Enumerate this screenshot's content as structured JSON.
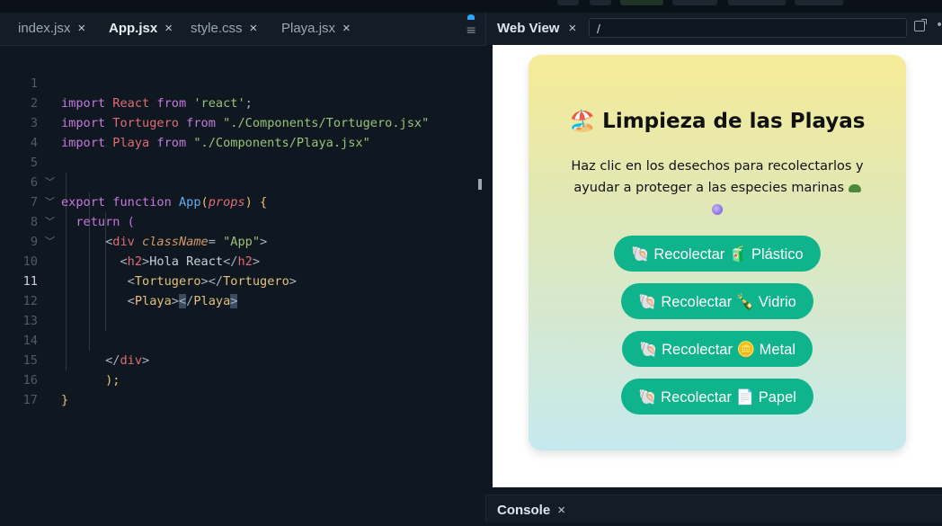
{
  "editor": {
    "tabs": [
      {
        "label": "index.jsx",
        "close": "×"
      },
      {
        "label": "App.jsx",
        "close": "×"
      },
      {
        "label": "style.css",
        "close": "×"
      },
      {
        "label": "Playa.jsx",
        "close": "×"
      }
    ],
    "active_tab": "App.jsx",
    "menu_icon": "≡",
    "line_numbers": [
      "1",
      "2",
      "3",
      "4",
      "5",
      "6",
      "7",
      "8",
      "9",
      "10",
      "11",
      "12",
      "13",
      "14",
      "15",
      "16",
      "17"
    ],
    "current_line": "11",
    "code": {
      "l1": {
        "kw1": "import",
        "id": "React",
        "kw2": "from",
        "str": "'react'",
        "end": ";"
      },
      "l2": {
        "kw1": "import",
        "id": "Tortugero",
        "kw2": "from",
        "str": "\"./Components/Tortugero.jsx\""
      },
      "l3": {
        "kw1": "import",
        "id": "Playa",
        "kw2": "from",
        "str": "\"./Components/Playa.jsx\""
      },
      "l5": {
        "kw1": "export",
        "kw2": "function",
        "fn": "App",
        "open": "(",
        "param": "props",
        "close": ")",
        "brace": "{"
      },
      "l6": {
        "kw": "return",
        "paren": "("
      },
      "l7": {
        "lt": "<",
        "tag": "div",
        "attr": "className",
        "eq": "=",
        "str": "\"App\"",
        "gt": ">"
      },
      "l8": {
        "lt": "<",
        "tag": "h2",
        "gt": ">",
        "text": "Hola React",
        "lt2": "</",
        "tag2": "h2",
        "gt2": ">"
      },
      "l10": {
        "lt": "<",
        "tag": "Tortugero",
        "gt": ">",
        "lt2": "</",
        "tag2": "Tortugero",
        "gt2": ">"
      },
      "l11": {
        "lt": "<",
        "tag": "Playa",
        "gt": ">",
        "lt2": "<",
        "slash": "/",
        "tag2": "Playa",
        "gt2": ">"
      },
      "l14": {
        "lt": "</",
        "tag": "div",
        "gt": ">"
      },
      "l15": {
        "text": ");"
      },
      "l16": {
        "text": "}"
      }
    }
  },
  "webview": {
    "title": "Web View",
    "close": "×",
    "url": "/",
    "more": "•",
    "card": {
      "title_emoji": "🏖️",
      "title": "Limpieza de las Playas",
      "description": "Haz clic en los desechos para recolectarlos y ayudar a proteger a las especies marinas",
      "buttons": [
        {
          "label": "🐚 Recolectar 🧃 Plástico"
        },
        {
          "label": "🐚 Recolectar 🍾 Vidrio"
        },
        {
          "label": "🐚 Recolectar 🪙 Metal"
        },
        {
          "label": "🐚 Recolectar 📄 Papel"
        }
      ]
    }
  },
  "console": {
    "title": "Console",
    "close": "×"
  },
  "colors": {
    "button": "#10b48c",
    "card_top": "#f6eb97",
    "card_bottom": "#c6e9ee",
    "editor_bg": "#0f1720"
  }
}
